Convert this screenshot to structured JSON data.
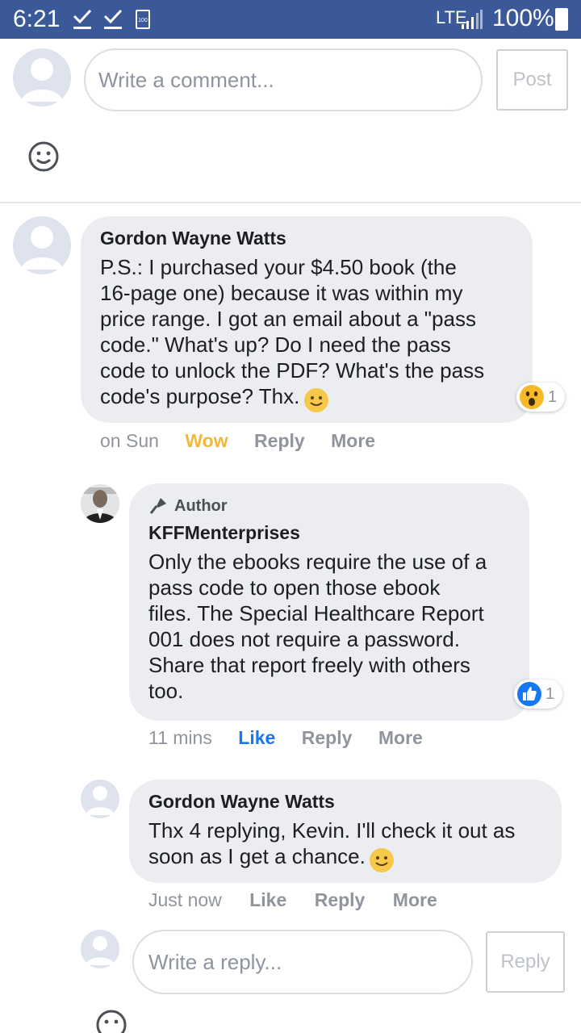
{
  "status_bar": {
    "time": "6:21",
    "battery_small_label": "100",
    "network": "LTE",
    "battery_percent": "100%"
  },
  "composer": {
    "placeholder": "Write a comment...",
    "post_label": "Post"
  },
  "comments": [
    {
      "author": "Gordon Wayne Watts",
      "text": "P.S.: I purchased your $4.50 book (the\n16-page one) because it was within my\nprice range. I got an email about a \"pass\ncode.\" What's up? Do I need the pass\ncode to unlock the PDF? What's the pass\ncode's purpose? Thx.",
      "reaction": {
        "type": "wow",
        "count": "1"
      },
      "time": "on Sun",
      "action_react": "Wow",
      "action_reply": "Reply",
      "action_more": "More"
    }
  ],
  "replies": [
    {
      "badge": "Author",
      "author": "KFFMenterprises",
      "text": "Only the ebooks require the use of a\npass code to open those ebook\nfiles. The Special Healthcare Report\n001 does not require a password.\nShare that report freely with others\ntoo.",
      "reaction": {
        "type": "like",
        "count": "1"
      },
      "time": "11 mins",
      "action_react": "Like",
      "action_reply": "Reply",
      "action_more": "More"
    },
    {
      "author": "Gordon Wayne Watts",
      "text": "Thx 4 replying, Kevin. I'll check it out as\nsoon as I get a chance.",
      "time": "Just now",
      "action_react": "Like",
      "action_reply": "Reply",
      "action_more": "More"
    }
  ],
  "reply_composer": {
    "placeholder": "Write a reply...",
    "reply_label": "Reply"
  },
  "colors": {
    "status_bar": "#3b5998",
    "wow_active": "#f0b93b",
    "like_active": "#1877f2",
    "bubble": "#ebedf0"
  }
}
